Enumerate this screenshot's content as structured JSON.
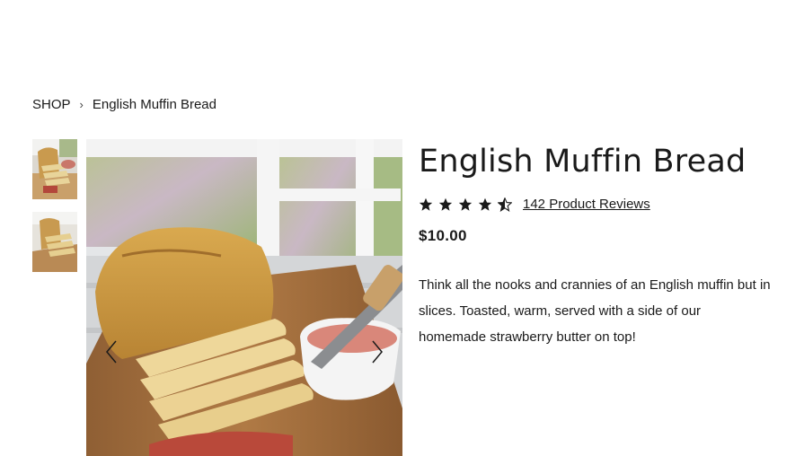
{
  "breadcrumb": {
    "shop": "SHOP",
    "separator": "›",
    "current": "English Muffin Bread"
  },
  "product": {
    "title": "English Muffin Bread",
    "rating": 4.5,
    "reviews_label": "142 Product Reviews",
    "price": "$10.00",
    "description": "Think all the nooks and crannies of an English muffin but in slices. Toasted, warm, served with a side of our homemade strawberry butter on top!"
  },
  "gallery": {
    "thumbnail_count": 2,
    "icons": {
      "prev": "chevron-left-icon",
      "next": "chevron-right-icon",
      "star": "star-icon"
    }
  },
  "colors": {
    "text": "#1a1a1a",
    "star": "#1a1a1a",
    "background": "#ffffff"
  }
}
